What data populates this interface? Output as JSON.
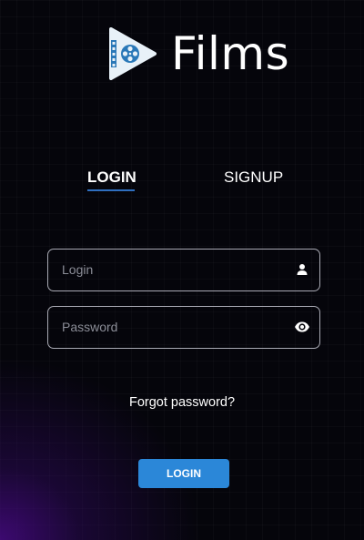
{
  "app": {
    "name": "Films",
    "logo_icon": "film-play-icon"
  },
  "tabs": [
    {
      "label": "LOGIN",
      "active": true
    },
    {
      "label": "SIGNUP",
      "active": false
    }
  ],
  "form": {
    "login": {
      "placeholder": "Login",
      "value": "",
      "icon": "user-icon"
    },
    "password": {
      "placeholder": "Password",
      "value": "",
      "icon": "eye-icon"
    },
    "forgot_label": "Forgot password?",
    "submit_label": "LOGIN"
  },
  "colors": {
    "accent": "#2b87d8",
    "tab_underline": "#2f6fc0",
    "field_border": "#a9aab4",
    "background": "#05050b",
    "glow": "#460a82"
  }
}
